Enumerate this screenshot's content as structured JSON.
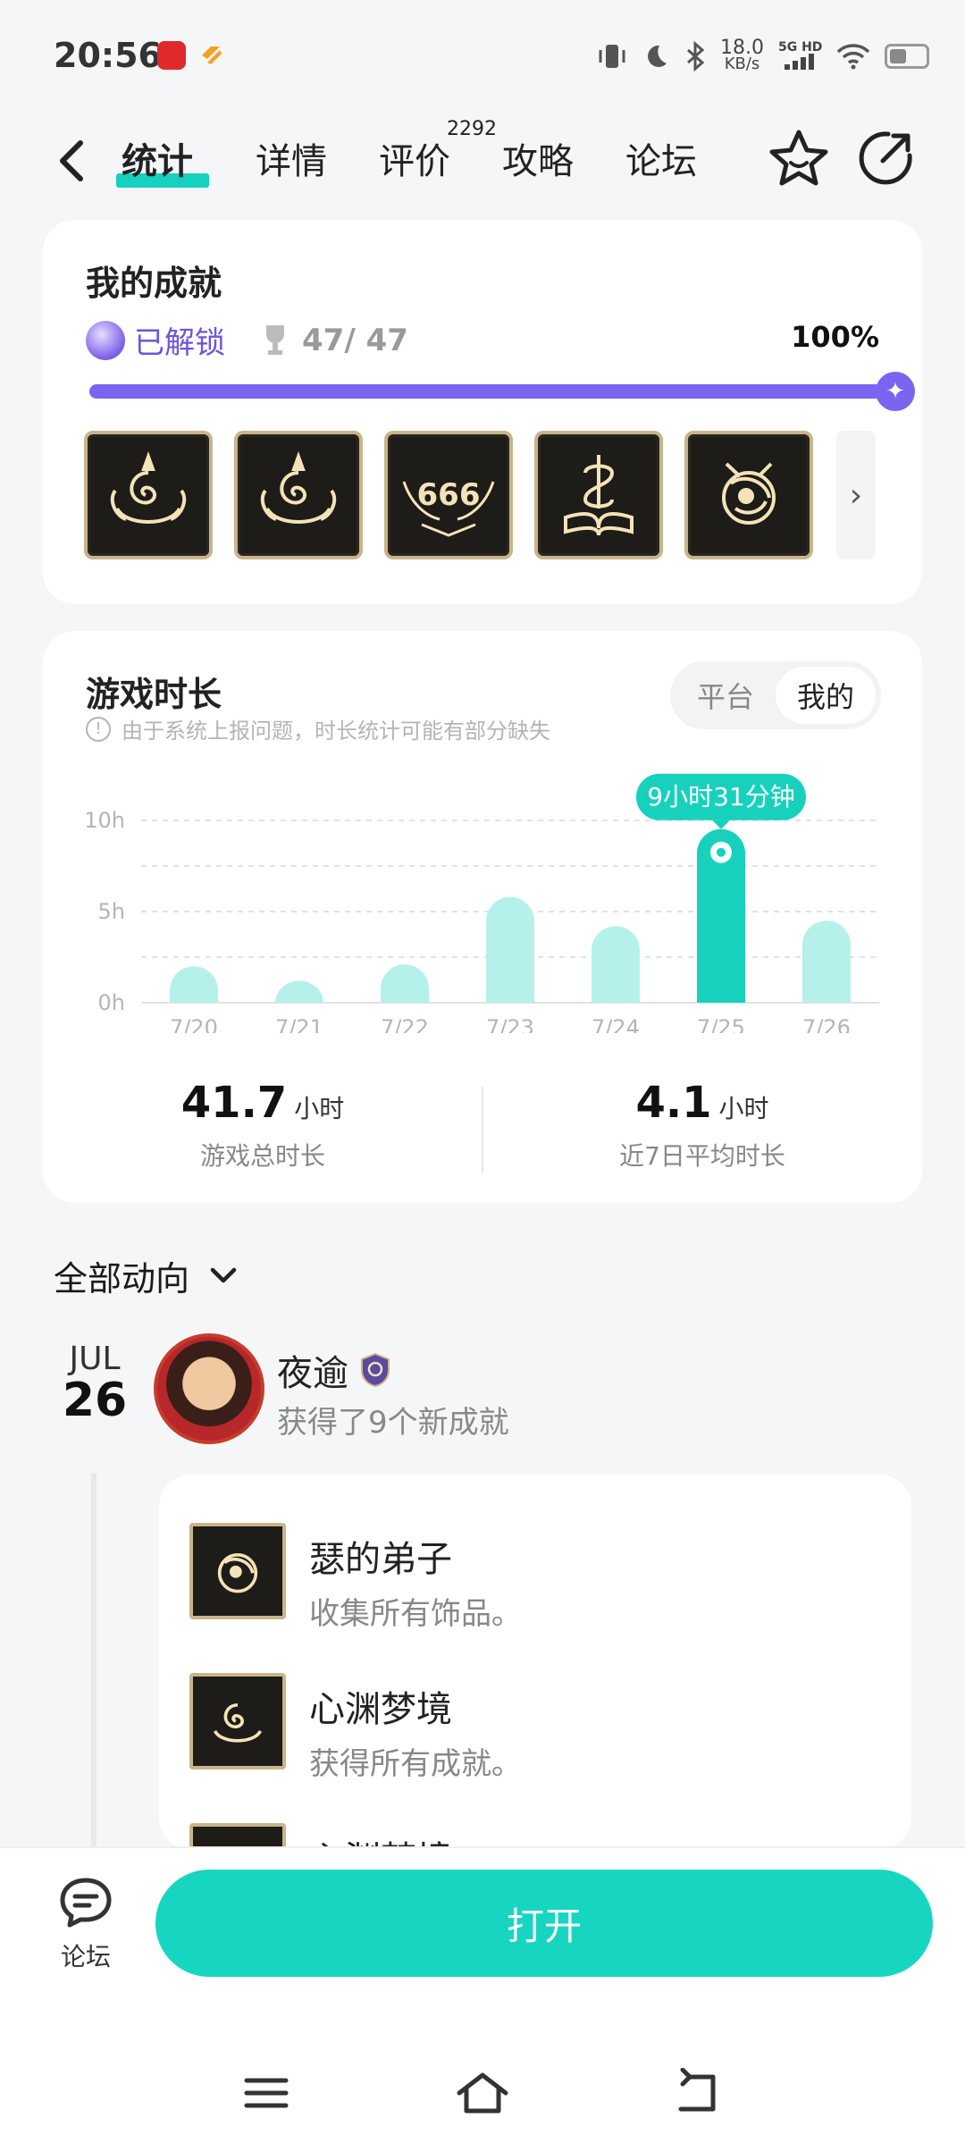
{
  "status_bar": {
    "time": "20:56",
    "network_speed": "18.0",
    "network_unit": "KB/s",
    "signal_label": "5G HD"
  },
  "nav": {
    "tabs": [
      {
        "label": "统计",
        "active": true
      },
      {
        "label": "详情",
        "active": false
      },
      {
        "label": "评价",
        "active": false,
        "badge": "2292"
      },
      {
        "label": "攻略",
        "active": false
      },
      {
        "label": "论坛",
        "active": false
      }
    ]
  },
  "achievements": {
    "title": "我的成就",
    "unlocked_label": "已解锁",
    "count": "47/ 47",
    "percent": "100%",
    "progress": 1.0,
    "badges": [
      "spiral-badge",
      "spiral-badge",
      "666-badge",
      "book-badge",
      "orb-badge"
    ]
  },
  "playtime": {
    "title": "游戏时长",
    "segment": {
      "options": [
        "平台",
        "我的"
      ],
      "selected": "我的"
    },
    "notice": "由于系统上报问题，时长统计可能有部分缺失",
    "total_value": "41.7",
    "total_unit": "小时",
    "total_label": "游戏总时长",
    "avg_value": "4.1",
    "avg_unit": "小时",
    "avg_label": "近7日平均时长"
  },
  "chart_data": {
    "type": "bar",
    "categories": [
      "7/20",
      "7/21",
      "7/22",
      "7/23",
      "7/24",
      "7/25",
      "7/26"
    ],
    "values": [
      2.0,
      1.2,
      2.1,
      5.8,
      4.2,
      9.52,
      4.5
    ],
    "yticks": [
      "10h",
      "5h",
      "0h"
    ],
    "ylim": [
      0,
      10
    ],
    "highlight_index": 5,
    "tooltip": "9小时31分钟",
    "grid": true,
    "colors": {
      "bar": "#b5f1ea",
      "highlight": "#17d1bd"
    }
  },
  "feed": {
    "header": "全部动向",
    "month": "JUL",
    "day": "26",
    "user": "夜逾",
    "summary": "获得了9个新成就",
    "items": [
      {
        "name": "瑟的弟子",
        "desc": "收集所有饰品。"
      },
      {
        "name": "心渊梦境",
        "desc": "获得所有成就。"
      },
      {
        "name": "心渊梦境",
        "desc": ""
      }
    ]
  },
  "bottom": {
    "forum_label": "论坛",
    "open_label": "打开"
  }
}
